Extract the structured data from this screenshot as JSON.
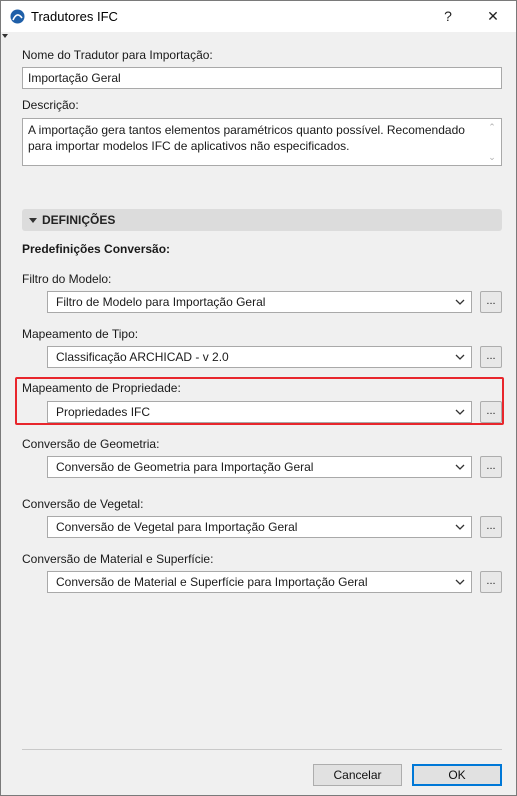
{
  "window": {
    "title": "Tradutores IFC",
    "help_glyph": "?",
    "close_glyph": "✕"
  },
  "translator": {
    "name_label": "Nome do Tradutor para Importação:",
    "name_value": "Importação Geral",
    "description_label": "Descrição:",
    "description_value": "A importação gera tantos elementos paramétricos quanto possível. Recomendado para importar modelos IFC de aplicativos não especificados."
  },
  "section": {
    "title": "DEFINIÇÕES",
    "presets_label": "Predefinições Conversão:"
  },
  "settings": [
    {
      "label": "Filtro do Modelo:",
      "value": "Filtro de Modelo para Importação Geral",
      "button": "..."
    },
    {
      "label": "Mapeamento de Tipo:",
      "value": "Classificação ARCHICAD - v 2.0",
      "button": "..."
    },
    {
      "label": "Mapeamento de Propriedade:",
      "value": "Propriedades IFC",
      "button": "..."
    },
    {
      "label": "Conversão de Geometria:",
      "value": "Conversão de Geometria para Importação Geral",
      "button": "..."
    },
    {
      "label": "Conversão de Vegetal:",
      "value": "Conversão de Vegetal para Importação Geral",
      "button": "..."
    },
    {
      "label": "Conversão de Material e Superfície:",
      "value": "Conversão de Material e Superfície para Importação Geral",
      "button": "..."
    }
  ],
  "footer": {
    "cancel_label": "Cancelar",
    "ok_label": "OK"
  },
  "colors": {
    "highlight": "#e8262c",
    "default_button_border": "#0078d7"
  }
}
